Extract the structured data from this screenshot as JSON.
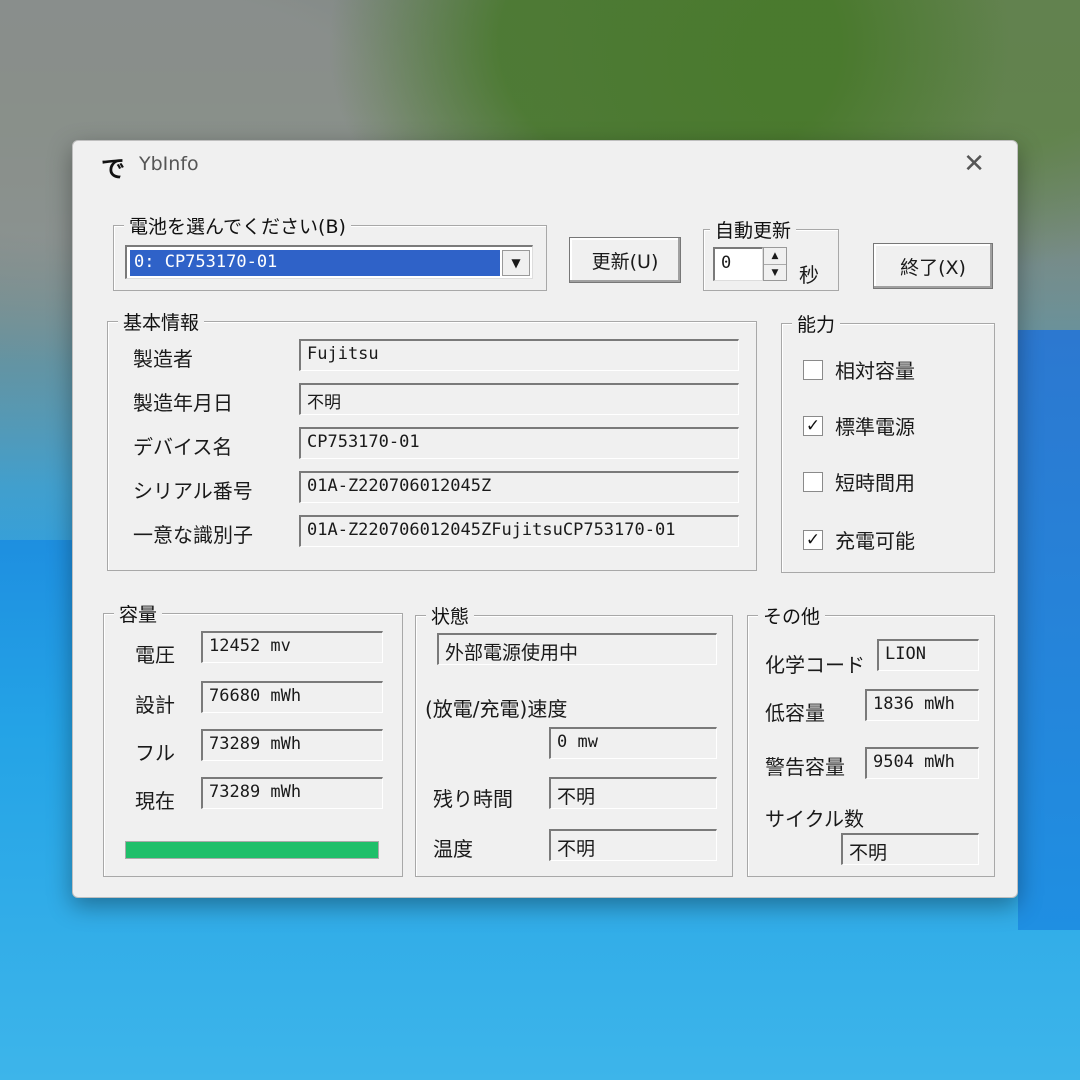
{
  "window": {
    "icon_glyph": "で",
    "title": "YbInfo",
    "close_glyph": "✕"
  },
  "battery_select": {
    "label": "電池を選んでください(B)",
    "selected": "0: CP753170-01",
    "refresh_button": "更新(U)"
  },
  "auto_refresh": {
    "label": "自動更新",
    "value": "0",
    "unit": "秒"
  },
  "exit_button": "終了(X)",
  "basic_info": {
    "label": "基本情報",
    "fields": [
      {
        "label": "製造者",
        "value": "Fujitsu"
      },
      {
        "label": "製造年月日",
        "value": "不明"
      },
      {
        "label": "デバイス名",
        "value": "CP753170-01"
      },
      {
        "label": "シリアル番号",
        "value": "01A-Z220706012045Z"
      },
      {
        "label": "一意な識別子",
        "value": "01A-Z220706012045ZFujitsuCP753170-01"
      }
    ]
  },
  "capabilities": {
    "label": "能力",
    "items": [
      {
        "label": "相対容量",
        "checked": false,
        "mark": ""
      },
      {
        "label": "標準電源",
        "checked": true,
        "mark": "✓"
      },
      {
        "label": "短時間用",
        "checked": false,
        "mark": ""
      },
      {
        "label": "充電可能",
        "checked": true,
        "mark": "✓"
      }
    ]
  },
  "capacity": {
    "label": "容量",
    "fields": [
      {
        "label": "電圧",
        "value": "12452 mv"
      },
      {
        "label": "設計",
        "value": "76680 mWh"
      },
      {
        "label": "フル",
        "value": "73289 mWh"
      },
      {
        "label": "現在",
        "value": "73289 mWh"
      }
    ],
    "charge_fraction": 1.0
  },
  "status": {
    "label": "状態",
    "power_state": "外部電源使用中",
    "rate_label": "(放電/充電)速度",
    "rate_value": "0 mw",
    "remaining_label": "残り時間",
    "remaining_value": "不明",
    "temp_label": "温度",
    "temp_value": "不明"
  },
  "other": {
    "label": "その他",
    "chem_label": "化学コード",
    "chem_value": "LION",
    "low_label": "低容量",
    "low_value": "1836 mWh",
    "warn_label": "警告容量",
    "warn_value": "9504 mWh",
    "cycle_label": "サイクル数",
    "cycle_value": "不明"
  },
  "colors": {
    "selection": "#2f62c8",
    "progress": "#1fbf6a"
  }
}
